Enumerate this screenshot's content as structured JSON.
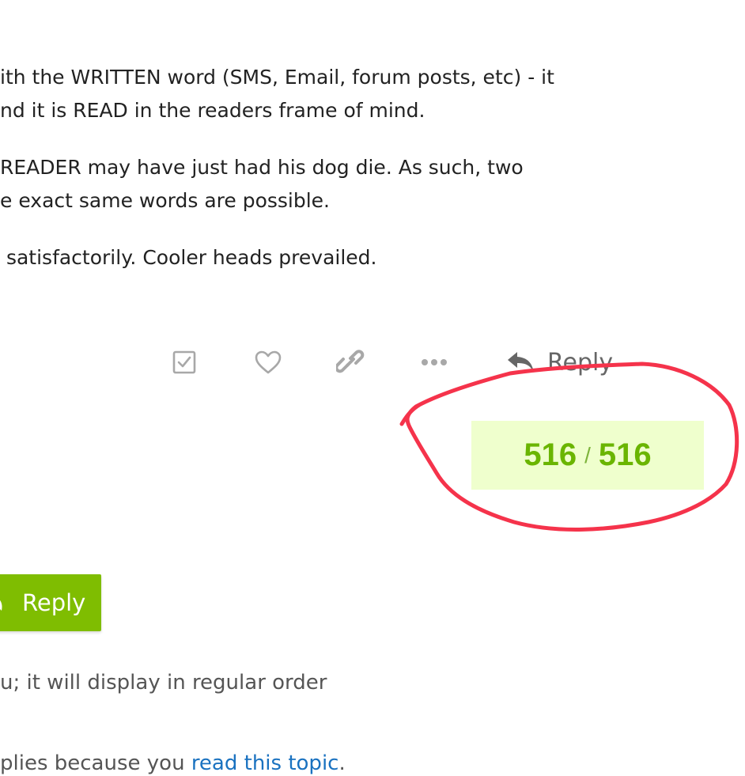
{
  "post": {
    "paragraphs": [
      {
        "line1": "ith the WRITTEN word (SMS, Email, forum posts, etc) - it",
        "line2": "nd it is READ in the readers frame of mind."
      },
      {
        "line1": "READER may have just had his dog die. As such, two",
        "line2": "e exact same words are possible."
      },
      {
        "line1": " satisfactorily. Cooler heads prevailed."
      }
    ],
    "actions": {
      "bookmark_icon": "check-square-icon",
      "like_icon": "heart-icon",
      "link_icon": "link-icon",
      "more_icon": "ellipsis-icon",
      "reply_icon": "reply-arrow-icon",
      "reply_label": "Reply"
    }
  },
  "progress": {
    "current": "516",
    "separator": "/",
    "total": "516"
  },
  "annotation": {
    "type": "freehand-circle",
    "color": "#f5334b"
  },
  "footer": {
    "reply_button_label": "Reply",
    "reply_button_icon": "reply-arrow-icon",
    "order_note": "u; it will display in regular order",
    "notification_prefix": "plies because you ",
    "notification_link": "read this topic",
    "notification_suffix": "."
  },
  "colors": {
    "accent_green": "#7fbd01",
    "progress_bg": "#efffcd",
    "progress_text": "#6ab500",
    "link_blue": "#1a72c0",
    "muted_icon": "#9a9a9a"
  }
}
